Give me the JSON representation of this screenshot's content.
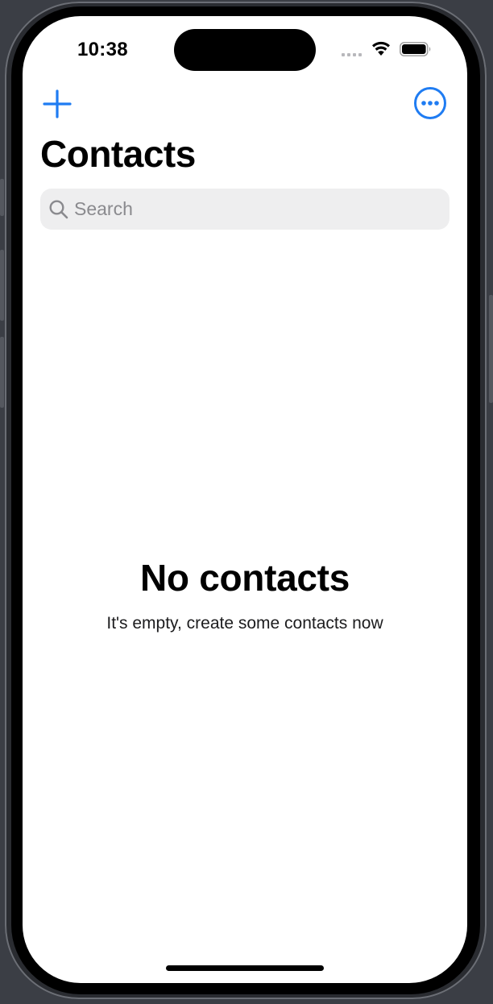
{
  "status_bar": {
    "time": "10:38",
    "icons": [
      "cellular-signal-icon",
      "wifi-icon",
      "battery-icon"
    ]
  },
  "nav": {
    "add_icon": "plus-icon",
    "more_icon": "ellipsis-circle-icon",
    "accent_color": "#1f7cf2"
  },
  "header": {
    "title": "Contacts"
  },
  "search": {
    "placeholder": "Search",
    "value": ""
  },
  "empty_state": {
    "title": "No contacts",
    "message": "It's empty, create some contacts now"
  }
}
